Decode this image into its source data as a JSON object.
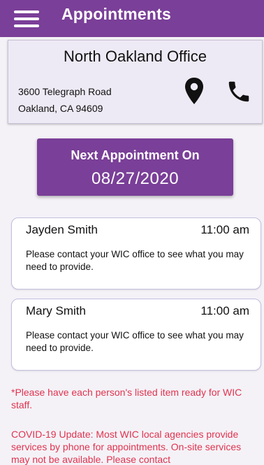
{
  "header": {
    "title": "Appointments",
    "menu_icon": "hamburger-menu-icon",
    "background": "#7a3f98"
  },
  "office": {
    "name": "North Oakland Office",
    "address_line1": "3600 Telegraph Road",
    "address_line2": "Oakland, CA 94609",
    "location_icon": "map-pin-icon",
    "phone_icon": "phone-icon"
  },
  "next_appointment": {
    "label": "Next Appointment On",
    "date": "08/27/2020"
  },
  "appointments": [
    {
      "name": "Jayden Smith",
      "time": "11:00 am",
      "note": "Please contact your WIC office to see what you may need to provide."
    },
    {
      "name": "Mary Smith",
      "time": "11:00 am",
      "note": "Please contact your WIC office to see what you may need to provide."
    }
  ],
  "notes": {
    "items_notice": "*Please have each person's listed item ready for WIC staff.",
    "covid_notice": "COVID-19 Update: Most WIC local agencies provide services by phone for appointments. On-site services may not be available. Please contact"
  },
  "colors": {
    "accent": "#7a3f98",
    "notice_red": "#e0334f"
  }
}
